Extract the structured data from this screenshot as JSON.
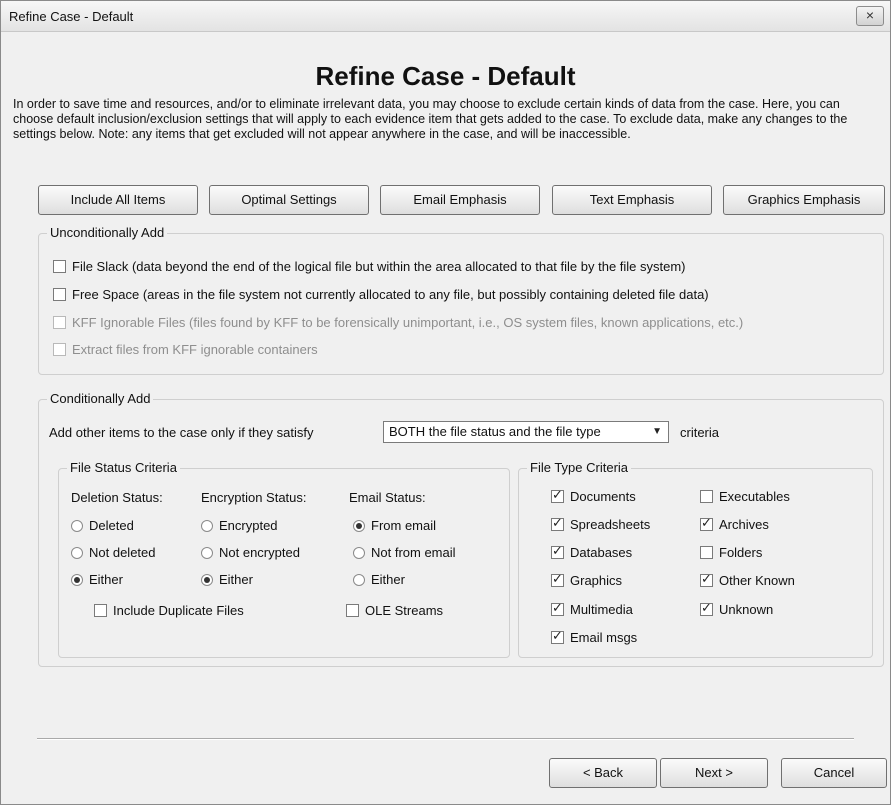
{
  "window": {
    "title": "Refine Case - Default",
    "close_icon": "×"
  },
  "heading": "Refine Case - Default",
  "intro": "In order to save time and resources, and/or to eliminate irrelevant data, you may choose to exclude certain kinds of data from the case. Here, you can choose default inclusion/exclusion settings that will apply to each evidence item that gets added to the case. To exclude data, make any changes to the settings below. Note: any items that get excluded will not appear anywhere in the case, and will be inaccessible.",
  "presets": [
    "Include All Items",
    "Optimal Settings",
    "Email Emphasis",
    "Text Emphasis",
    "Graphics Emphasis"
  ],
  "unconditional": {
    "label": "Unconditionally Add",
    "items": [
      {
        "label": "File Slack (data beyond the end of the logical file but within the area allocated to that file by the file system)",
        "checked": false,
        "enabled": true
      },
      {
        "label": "Free Space (areas in the file system not currently allocated to any file, but possibly containing deleted file data)",
        "checked": false,
        "enabled": true
      },
      {
        "label": "KFF Ignorable Files (files found by KFF to be forensically unimportant, i.e., OS system files, known applications, etc.)",
        "checked": false,
        "enabled": false
      },
      {
        "label": "Extract files from KFF ignorable containers",
        "checked": false,
        "enabled": false
      }
    ]
  },
  "conditional": {
    "label": "Conditionally Add",
    "criteria_prefix": "Add other items to the case only if they satisfy",
    "criteria_value": "BOTH the file status and the file type",
    "criteria_suffix": "criteria",
    "file_status": {
      "label": "File Status Criteria",
      "deletion": {
        "label": "Deletion Status:",
        "options": [
          "Deleted",
          "Not deleted",
          "Either"
        ],
        "selected": 2
      },
      "encryption": {
        "label": "Encryption Status:",
        "options": [
          "Encrypted",
          "Not encrypted",
          "Either"
        ],
        "selected": 2
      },
      "email": {
        "label": "Email Status:",
        "options": [
          "From email",
          "Not from email",
          "Either"
        ],
        "selected": 0
      },
      "include_duplicates": {
        "label": "Include Duplicate Files",
        "checked": false
      },
      "ole_streams": {
        "label": "OLE Streams",
        "checked": false
      }
    },
    "file_type": {
      "label": "File Type Criteria",
      "col1": [
        {
          "label": "Documents",
          "checked": true
        },
        {
          "label": "Spreadsheets",
          "checked": true
        },
        {
          "label": "Databases",
          "checked": true
        },
        {
          "label": "Graphics",
          "checked": true
        },
        {
          "label": "Multimedia",
          "checked": true
        },
        {
          "label": "Email msgs",
          "checked": true
        }
      ],
      "col2": [
        {
          "label": "Executables",
          "checked": false
        },
        {
          "label": "Archives",
          "checked": true
        },
        {
          "label": "Folders",
          "checked": false
        },
        {
          "label": "Other Known",
          "checked": true
        },
        {
          "label": "Unknown",
          "checked": true
        }
      ]
    }
  },
  "nav": {
    "back": "< Back",
    "next": "Next >",
    "cancel": "Cancel"
  }
}
